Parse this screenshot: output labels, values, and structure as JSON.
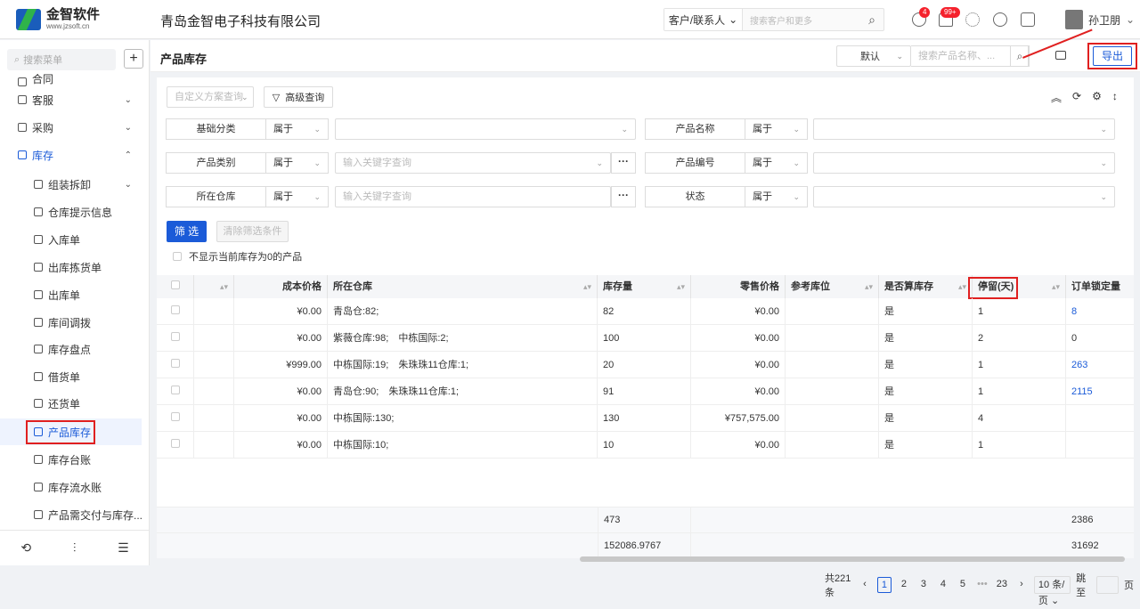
{
  "logo": {
    "name": "金智软件",
    "url": "www.jzsoft.cn"
  },
  "header": {
    "company": "青岛金智电子科技有限公司",
    "search_type": "客户/联系人",
    "search_placeholder": "搜索客户和更多",
    "badge1": "4",
    "badge2": "99+",
    "user": "孙卫朋"
  },
  "sidebar": {
    "search_placeholder": "搜索菜单",
    "items": [
      {
        "label": "合同"
      },
      {
        "label": "客服"
      },
      {
        "label": "采购"
      },
      {
        "label": "库存"
      },
      {
        "label": "组装拆卸"
      },
      {
        "label": "仓库提示信息"
      },
      {
        "label": "入库单"
      },
      {
        "label": "出库拣货单"
      },
      {
        "label": "出库单"
      },
      {
        "label": "库间调拨"
      },
      {
        "label": "库存盘点"
      },
      {
        "label": "借货单"
      },
      {
        "label": "还货单"
      },
      {
        "label": "产品库存"
      },
      {
        "label": "库存台账"
      },
      {
        "label": "库存流水账"
      },
      {
        "label": "产品需交付与库存..."
      }
    ]
  },
  "titlebar": {
    "title": "产品库存",
    "default_option": "默认",
    "search_placeholder": "搜索产品名称、...",
    "export_label": "导出"
  },
  "filters": {
    "custom_placeholder": "自定义方案查询",
    "advanced_label": "高级查询",
    "rows": [
      {
        "label": "基础分类",
        "op": "属于",
        "value": ""
      },
      {
        "label": "产品名称",
        "op": "属于",
        "value": ""
      },
      {
        "label": "产品类别",
        "op": "属于",
        "value": "输入关键字查询"
      },
      {
        "label": "产品编号",
        "op": "属于",
        "value": ""
      },
      {
        "label": "所在仓库",
        "op": "属于",
        "value": "输入关键字查询"
      },
      {
        "label": "状态",
        "op": "属于",
        "value": ""
      }
    ],
    "filter_btn": "筛 选",
    "clear_btn": "清除筛选条件",
    "hide_zero": "不显示当前库存为0的产品"
  },
  "table": {
    "headers": [
      "成本价格",
      "所在仓库",
      "库存量",
      "零售价格",
      "参考库位",
      "是否算库存",
      "停留(天)",
      "订单锁定量"
    ],
    "rows": [
      {
        "cost": "¥0.00",
        "wh": "青岛仓:82;",
        "qty": "82",
        "retail": "¥0.00",
        "loc": "",
        "count": "是",
        "stay": "1",
        "lock": "8",
        "lock_link": true
      },
      {
        "cost": "¥0.00",
        "wh": "紫薇仓库:98;　中栋国际:2;",
        "qty": "100",
        "retail": "¥0.00",
        "loc": "",
        "count": "是",
        "stay": "2",
        "lock": "0",
        "lock_link": false
      },
      {
        "cost": "¥999.00",
        "wh": "中栋国际:19;　朱珠珠11仓库:1;",
        "qty": "20",
        "retail": "¥0.00",
        "loc": "",
        "count": "是",
        "stay": "1",
        "lock": "263",
        "lock_link": true
      },
      {
        "cost": "¥0.00",
        "wh": "青岛仓:90;　朱珠珠11仓库:1;",
        "qty": "91",
        "retail": "¥0.00",
        "loc": "",
        "count": "是",
        "stay": "1",
        "lock": "2115",
        "lock_link": true
      },
      {
        "cost": "¥0.00",
        "wh": "中栋国际:130;",
        "qty": "130",
        "retail": "¥757,575.00",
        "loc": "",
        "count": "是",
        "stay": "4",
        "lock": "",
        "lock_link": false
      },
      {
        "cost": "¥0.00",
        "wh": "中栋国际:10;",
        "qty": "10",
        "retail": "¥0.00",
        "loc": "",
        "count": "是",
        "stay": "1",
        "lock": "",
        "lock_link": false
      }
    ],
    "sum1": {
      "qty": "473",
      "lock": "2386"
    },
    "sum2": {
      "qty": "152086.9767",
      "lock": "31692"
    }
  },
  "pager": {
    "total": "共221条",
    "pages": [
      "1",
      "2",
      "3",
      "4",
      "5",
      "•••",
      "23"
    ],
    "size": "10 条/页",
    "jump_label": "跳至",
    "page_unit": "页"
  }
}
